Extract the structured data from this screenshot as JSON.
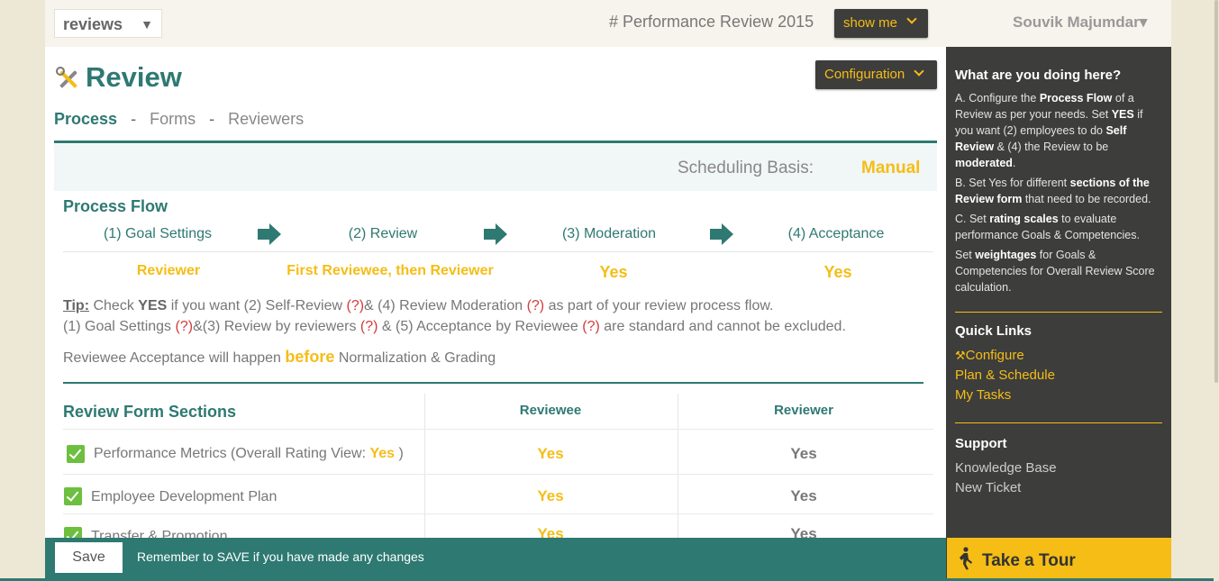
{
  "topbar": {
    "module_select": "reviews",
    "review_cycle": "# Performance Review 2015",
    "show_me": "show me",
    "user_name": "Souvik Majumdar",
    "user_caret": "▾"
  },
  "main": {
    "title": "Review",
    "configuration_button": "Configuration",
    "tabs": [
      {
        "label": "Process",
        "active": true
      },
      {
        "label": "Forms",
        "active": false
      },
      {
        "label": "Reviewers",
        "active": false
      }
    ],
    "tab_separator": "-",
    "scheduling": {
      "label": "Scheduling Basis:",
      "value": "Manual"
    },
    "process_flow": {
      "title": "Process Flow",
      "steps": [
        {
          "label": "(1) Goal Settings",
          "value": "Reviewer"
        },
        {
          "label": "(2) Review",
          "value": "First Reviewee, then Reviewer"
        },
        {
          "label": "(3) Moderation",
          "value": "Yes"
        },
        {
          "label": "(4) Acceptance",
          "value": "Yes"
        }
      ]
    },
    "tip": {
      "label": "Tip:",
      "line1": {
        "a": " Check ",
        "b": "YES",
        "c": " if you want (2) Self-Review ",
        "q1": "(?)",
        "d": "& (4) Review Moderation ",
        "q2": "(?)",
        "e": " as part of your review process flow."
      },
      "line2": {
        "a": "(1) Goal Settings ",
        "q1": "(?)",
        "b": "&(3) Review by reviewers ",
        "q2": "(?)",
        "c": " & (5) Acceptance by Reviewee ",
        "q3": "(?)",
        "d": " are standard and cannot be excluded."
      }
    },
    "acceptance_note": {
      "pre": "Reviewee Acceptance will happen ",
      "emph": "before",
      "post": " Normalization & Grading"
    },
    "form_sections": {
      "title": "Review Form Sections",
      "col_reviewee": "Reviewee",
      "col_reviewer": "Reviewer",
      "rows": [
        {
          "label": "Performance Metrics (Overall Rating View: ",
          "label_yes": "Yes",
          "label_end": " )",
          "reviewee": "Yes",
          "reviewer": "Yes"
        },
        {
          "label": "Employee Development Plan",
          "reviewee": "Yes",
          "reviewer": "Yes"
        },
        {
          "label": "Transfer & Promotion",
          "reviewee": "Yes",
          "reviewer": "Yes"
        }
      ]
    }
  },
  "sidebar": {
    "help_title": "What are you doing here?",
    "help": {
      "a": {
        "t1": "A. Configure the ",
        "b1": "Process Flow",
        "t2": " of a Review as per your needs. Set ",
        "b2": "YES",
        "t3": " if you want (2) employees to do ",
        "b3": "Self Review",
        "t4": " & (4) the Review to be ",
        "b4": "moderated",
        "t5": "."
      },
      "b": {
        "t1": "B. Set Yes for different ",
        "b1": "sections of the Review form",
        "t2": " that need to be recorded."
      },
      "c": {
        "t1": "C. Set ",
        "b1": "rating scales",
        "t2": " to evaluate performance Goals & Competencies."
      },
      "d": {
        "t1": "Set ",
        "b1": "weightages",
        "t2": " for Goals & Competencies for Overall Review Score calculation."
      }
    },
    "quick_links_title": "Quick Links",
    "quick_links": [
      "Configure",
      "Plan & Schedule",
      "My Tasks"
    ],
    "support_title": "Support",
    "support_links": [
      "Knowledge Base",
      "New Ticket"
    ]
  },
  "bottombar": {
    "save": "Save",
    "note": "Remember to SAVE if you have made any changes",
    "tour": "Take a Tour"
  },
  "colors": {
    "teal": "#2e7972",
    "accent": "#f5bd16",
    "dark": "#3d3d3b",
    "check": "#6cbf3f"
  }
}
